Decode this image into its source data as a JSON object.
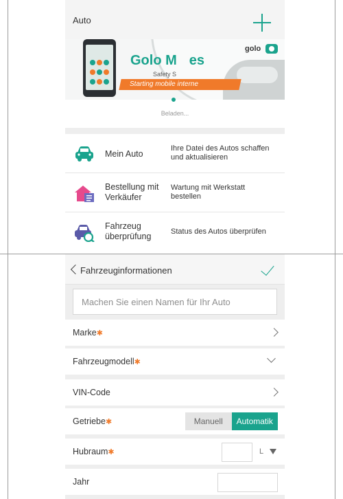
{
  "top_screen": {
    "header": {
      "title": "Auto",
      "add_icon": "plus-icon"
    },
    "banner": {
      "brand_text": "Golo M",
      "brand_text_tail": "es",
      "safety_text": "Safety S",
      "stripe_text": "Starting mobile interne",
      "badge_text": "golo"
    },
    "loading_text": "Beladen...",
    "menu": [
      {
        "icon": "car-icon",
        "label": "Mein Auto",
        "description": "Ihre Datei des Autos schaffen und aktualisieren"
      },
      {
        "icon": "house-order-icon",
        "label": "Bestellung mit Verkäufer",
        "description": "Wartung mit Werkstatt bestellen"
      },
      {
        "icon": "car-search-icon",
        "label": "Fahrzeug überprüfung",
        "description": "Status des Autos überprüfen"
      }
    ]
  },
  "bottom_screen": {
    "header": {
      "title": "Fahrzeuginformationen",
      "back_icon": "chevron-left-icon",
      "confirm_icon": "checkmark-icon"
    },
    "name_field": {
      "placeholder": "Machen Sie einen Namen für Ihr Auto",
      "value": ""
    },
    "fields": {
      "marke": {
        "label": "Marke",
        "required_mark": "✱"
      },
      "fahrzeugmodell": {
        "label": "Fahrzeugmodell",
        "required_mark": "✱"
      },
      "vin": {
        "label": "VIN-Code"
      },
      "getriebe": {
        "label": "Getriebe",
        "required_mark": "✱",
        "options": [
          "Manuell",
          "Automatik"
        ],
        "selected": "Automatik"
      },
      "hubraum": {
        "label": "Hubraum",
        "required_mark": "✱",
        "unit": "L"
      },
      "jahr": {
        "label": "Jahr"
      }
    }
  },
  "colors": {
    "accent": "#1aa38d",
    "required": "#f07a2a",
    "icon_purple": "#5a5aa8",
    "icon_pink": "#e64a8c"
  }
}
